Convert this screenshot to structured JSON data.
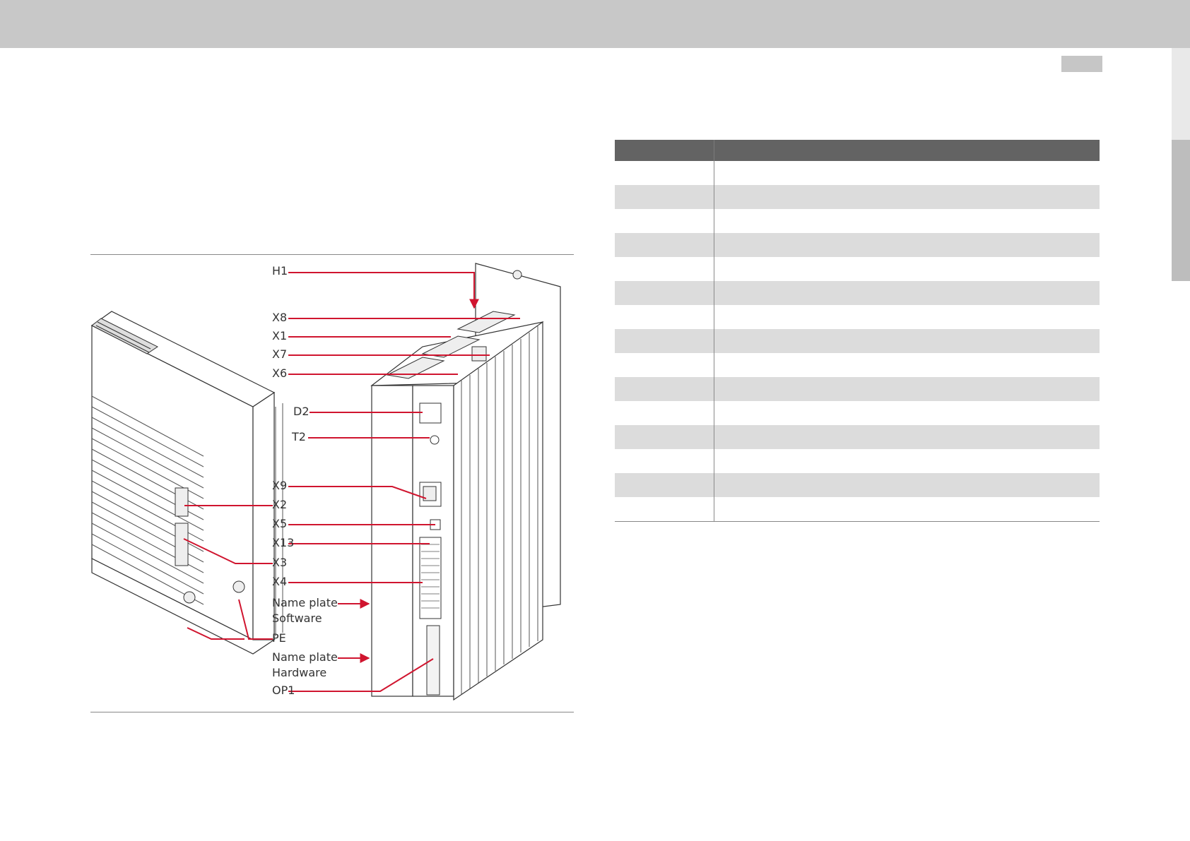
{
  "figure": {
    "callouts": [
      {
        "id": "h1",
        "text": "H1"
      },
      {
        "id": "x8",
        "text": "X8"
      },
      {
        "id": "x1",
        "text": "X1"
      },
      {
        "id": "x7",
        "text": "X7"
      },
      {
        "id": "x6",
        "text": "X6"
      },
      {
        "id": "d2",
        "text": "D2"
      },
      {
        "id": "t2",
        "text": "T2"
      },
      {
        "id": "x9",
        "text": "X9"
      },
      {
        "id": "x2",
        "text": "X2"
      },
      {
        "id": "x5",
        "text": "X5"
      },
      {
        "id": "x13",
        "text": "X13"
      },
      {
        "id": "x3",
        "text": "X3"
      },
      {
        "id": "x4",
        "text": "X4"
      },
      {
        "id": "nameplate-sw",
        "text": "Name plate"
      },
      {
        "id": "nameplate-sw-2",
        "text": "Software"
      },
      {
        "id": "pe",
        "text": "PE"
      },
      {
        "id": "nameplate-hw",
        "text": "Name plate"
      },
      {
        "id": "nameplate-hw-2",
        "text": "Hardware"
      },
      {
        "id": "op1",
        "text": "OP1"
      }
    ]
  },
  "colors": {
    "header_bar": "#c8c8c8",
    "table_header": "#636363",
    "row_shade": "#dcdcdc",
    "leader_line": "#d0152f"
  },
  "table": {
    "row_count": 15
  }
}
